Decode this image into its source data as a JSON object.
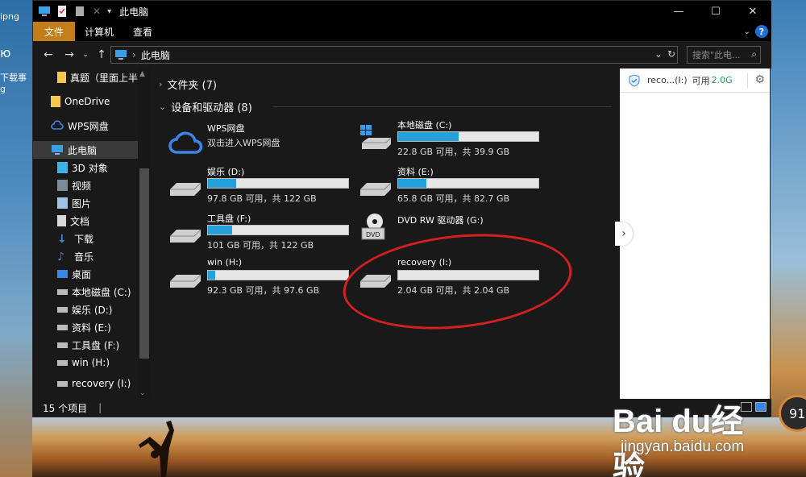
{
  "desktop": {
    "left_texts": [
      "ipng",
      "ю",
      "下载事",
      "g"
    ]
  },
  "window": {
    "title": "此电脑",
    "ribbon_tabs": [
      "文件",
      "计算机",
      "查看"
    ],
    "address": {
      "location": "此电脑"
    },
    "search": {
      "placeholder": "搜索\"此电..."
    },
    "controls": {
      "minimize": "—",
      "maximize": "☐",
      "close": "✕"
    }
  },
  "sidebar": {
    "items": [
      {
        "label": "真题（里面上半",
        "icon": "folder-icon"
      },
      {
        "label": "OneDrive",
        "icon": "folder-icon"
      },
      {
        "label": "WPS网盘",
        "icon": "cloud-icon"
      },
      {
        "label": "此电脑",
        "icon": "computer-icon",
        "selected": true
      },
      {
        "label": "3D 对象",
        "icon": "cube-icon"
      },
      {
        "label": "视频",
        "icon": "video-icon"
      },
      {
        "label": "图片",
        "icon": "image-icon"
      },
      {
        "label": "文档",
        "icon": "document-icon"
      },
      {
        "label": "下载",
        "icon": "download-icon"
      },
      {
        "label": "音乐",
        "icon": "music-icon"
      },
      {
        "label": "桌面",
        "icon": "desktop-icon"
      },
      {
        "label": "本地磁盘 (C:)",
        "icon": "drive-icon"
      },
      {
        "label": "娱乐 (D:)",
        "icon": "drive-icon"
      },
      {
        "label": "资料 (E:)",
        "icon": "drive-icon"
      },
      {
        "label": "工具盘 (F:)",
        "icon": "drive-icon"
      },
      {
        "label": "win (H:)",
        "icon": "drive-icon"
      },
      {
        "label": "recovery (I:)",
        "icon": "drive-icon"
      }
    ]
  },
  "content": {
    "folders_group": "文件夹 (7)",
    "devices_group": "设备和驱动器 (8)",
    "tiles": [
      {
        "name": "WPS网盘",
        "sub": "双击进入WPS网盘",
        "kind": "cloud"
      },
      {
        "name": "本地磁盘 (C:)",
        "info": "22.8 GB 可用，共 39.9 GB",
        "used": 0.43,
        "kind": "windrive"
      },
      {
        "name": "娱乐 (D:)",
        "info": "97.8 GB 可用，共 122 GB",
        "used": 0.2,
        "kind": "drive"
      },
      {
        "name": "资料 (E:)",
        "info": "65.8 GB 可用，共 82.7 GB",
        "used": 0.2,
        "kind": "drive"
      },
      {
        "name": "工具盘 (F:)",
        "info": "101 GB 可用，共 122 GB",
        "used": 0.17,
        "kind": "drive"
      },
      {
        "name": "DVD RW 驱动器 (G:)",
        "kind": "dvd"
      },
      {
        "name": "win (H:)",
        "info": "92.3 GB 可用，共 97.6 GB",
        "used": 0.05,
        "kind": "drive"
      },
      {
        "name": "recovery (I:)",
        "info": "2.04 GB 可用，共 2.04 GB",
        "used": 0.0,
        "kind": "drive"
      }
    ]
  },
  "panel": {
    "drive": "reco...(I:)",
    "free_label": "可用",
    "free_value": "2.0G"
  },
  "status": {
    "count": "15 个项目",
    "caret": "|"
  },
  "watermark": {
    "logo": "Bai du经验",
    "url": "jingyan.baidu.com"
  },
  "gauge": {
    "value": "91"
  },
  "colors": {
    "file_tab": "#c57d1a",
    "bar_fill": "#26a0da",
    "annotation": "#d21f1f",
    "free_green": "#1aa34a"
  }
}
